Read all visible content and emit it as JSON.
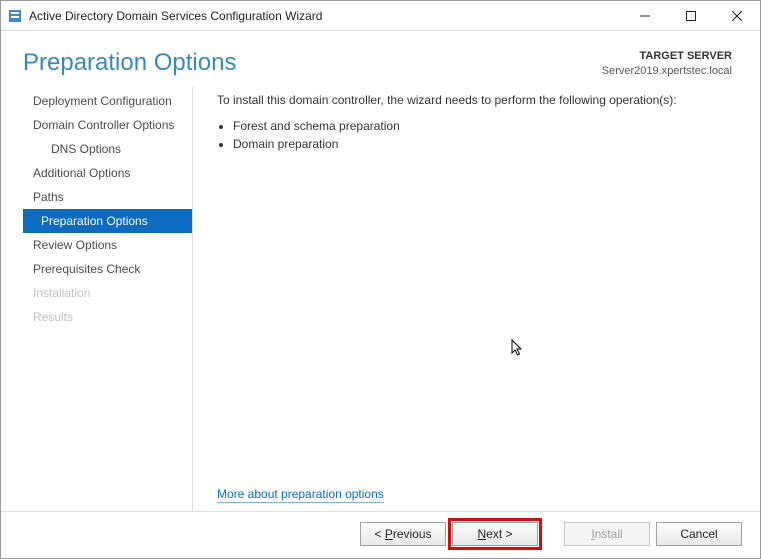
{
  "window": {
    "title": "Active Directory Domain Services Configuration Wizard"
  },
  "header": {
    "title": "Preparation Options",
    "target_label": "TARGET SERVER",
    "target_value": "Server2019.xpertstec.local"
  },
  "sidebar": {
    "items": [
      {
        "label": "Deployment Configuration"
      },
      {
        "label": "Domain Controller Options"
      },
      {
        "label": "DNS Options"
      },
      {
        "label": "Additional Options"
      },
      {
        "label": "Paths"
      },
      {
        "label": "Preparation Options"
      },
      {
        "label": "Review Options"
      },
      {
        "label": "Prerequisites Check"
      },
      {
        "label": "Installation"
      },
      {
        "label": "Results"
      }
    ]
  },
  "main": {
    "intro": "To install this domain controller, the wizard needs to perform the following operation(s):",
    "bullets": [
      "Forest and schema preparation",
      "Domain preparation"
    ],
    "help_link": "More about preparation options"
  },
  "footer": {
    "previous_mn": "P",
    "previous_rest": "revious",
    "next_mn": "N",
    "next_rest": "ext >",
    "install_mn": "I",
    "install_rest": "nstall",
    "cancel": "Cancel"
  }
}
